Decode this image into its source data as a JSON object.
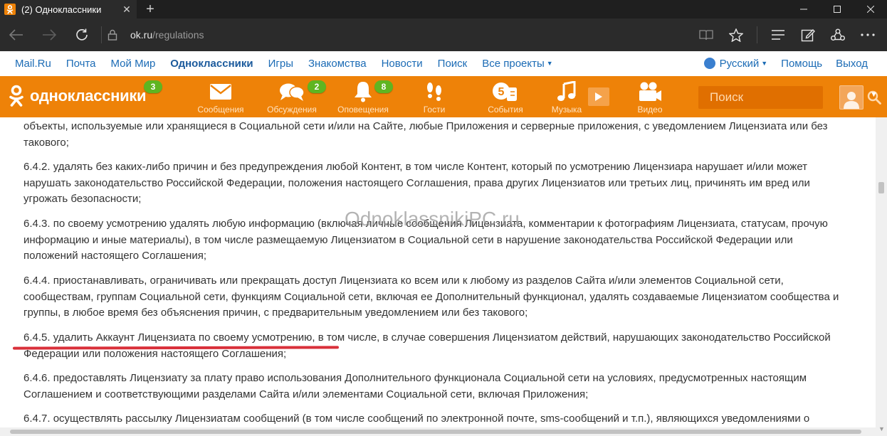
{
  "browser": {
    "tab_title": "(2) Одноклассники",
    "tab_favicon_glyph": "ok",
    "url_host": "ok.ru",
    "url_path": "/regulations"
  },
  "portal": {
    "links": [
      "Mail.Ru",
      "Почта",
      "Мой Мир",
      "Одноклассники",
      "Игры",
      "Знакомства",
      "Новости",
      "Поиск",
      "Все проекты"
    ],
    "active_link": "Одноклассники",
    "language": "Русский",
    "help": "Помощь",
    "logout": "Выход"
  },
  "ok_header": {
    "logo_text": "одноклассники",
    "logo_badge": "3",
    "nav": [
      {
        "label": "Сообщения",
        "icon": "envelope-icon",
        "badge": ""
      },
      {
        "label": "Обсуждения",
        "icon": "chat-bubbles-icon",
        "badge": "2"
      },
      {
        "label": "Оповещения",
        "icon": "bell-icon",
        "badge": "8"
      },
      {
        "label": "Гости",
        "icon": "footprints-icon",
        "badge": ""
      },
      {
        "label": "События",
        "icon": "events-icon",
        "badge": ""
      },
      {
        "label": "Музыка",
        "icon": "music-note-icon",
        "badge": ""
      },
      {
        "label": "Видео",
        "icon": "video-camera-icon",
        "badge": ""
      }
    ],
    "search_placeholder": "Поиск",
    "brand_color": "#ee8208",
    "badge_color": "#5fb521"
  },
  "content": {
    "watermark": "OdnoklassnikiPC.ru",
    "paragraphs": [
      "объекты, используемые или хранящиеся в Социальной сети и/или на Сайте, любые Приложения и серверные приложения, с уведомлением Лицензиата или без такового;",
      "6.4.2. удалять без каких-либо причин и без предупреждения любой Контент, в том числе Контент, который по усмотрению Лицензиара нарушает и/или может нарушать законодательство Российской Федерации, положения настоящего Соглашения, права других Лицензиатов или третьих лиц, причинять им вред или угрожать безопасности;",
      "6.4.3. по своему усмотрению удалять любую информацию (включая личные сообщения Лицензиата, комментарии к фотографиям Лицензиата, статусам, прочую информацию и иные материалы), в том числе размещаемую Лицензиатом в Социальной сети в нарушение законодательства Российской Федерации или положений настоящего Соглашения;",
      "6.4.4. приостанавливать, ограничивать или прекращать доступ Лицензиата ко всем или к любому из разделов Сайта и/или элементов Социальной сети, сообществам, группам Социальной сети, функциям Социальной сети, включая ее Дополнительный функционал, удалять создаваемые Лицензиатом сообщества и группы, в любое время без объяснения причин, с предварительным уведомлением или без такового;",
      "6.4.5. удалить Аккаунт Лицензиата по своему усмотрению, в том числе, в случае совершения Лицензиатом действий, нарушающих законодательство Российской Федерации или положения настоящего Соглашения;",
      "6.4.6. предоставлять Лицензиату за плату право использования Дополнительного функционала Социальной сети на условиях, предусмотренных настоящим Соглашением и соответствующими разделами Сайта и/или элементами Социальной сети, включая Приложения;",
      "6.4.7. осуществлять рассылку Лицензиатам сообщений (в том числе сообщений по электронной почте, sms-сообщений и т.п.), являющихся уведомлениями о"
    ],
    "highlight_color": "#d9303a"
  }
}
